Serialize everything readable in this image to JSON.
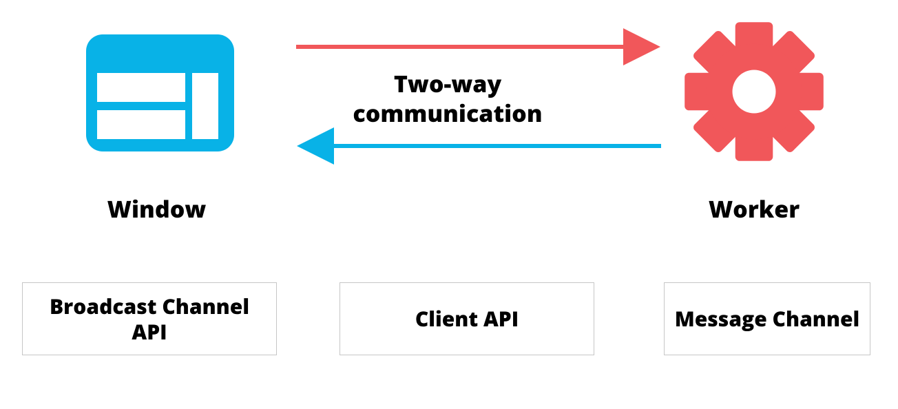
{
  "labels": {
    "center": "Two-way communication",
    "window": "Window",
    "worker": "Worker"
  },
  "boxes": {
    "broadcast": "Broadcast Channel API",
    "client": "Client API",
    "message": "Message Channel"
  },
  "colors": {
    "window_icon": "#08b2e7",
    "gear_icon": "#f1575a",
    "arrow_top": "#f1575a",
    "arrow_bottom": "#08b2e7",
    "box_border": "#c6c6c6"
  },
  "icons": {
    "window": "window-panel-icon",
    "worker": "gear-icon"
  }
}
